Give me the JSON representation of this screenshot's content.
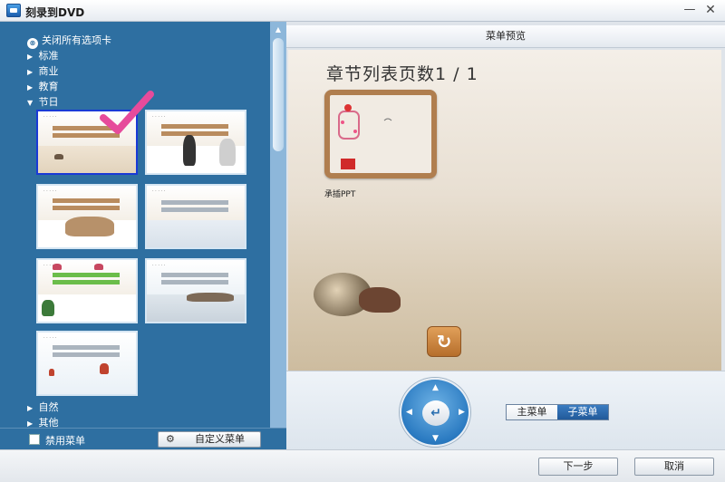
{
  "window": {
    "title": "刻录到DVD",
    "min_glyph": "—",
    "close_glyph": "✕"
  },
  "tree": {
    "close_all": "关闭所有选项卡",
    "categories": [
      {
        "label": "标准",
        "expanded": false
      },
      {
        "label": "商业",
        "expanded": false
      },
      {
        "label": "教育",
        "expanded": false
      },
      {
        "label": "节日",
        "expanded": true
      },
      {
        "label": "自然",
        "expanded": false
      },
      {
        "label": "其他",
        "expanded": false
      }
    ],
    "selected_template_index": 0
  },
  "left_bottom": {
    "disable_menu_label": "禁用菜单",
    "disable_menu_checked": false,
    "custom_menu_label": "自定义菜单"
  },
  "preview": {
    "header": "菜单预览",
    "page_title": "章节列表页数1 / 1",
    "chapter_caption": "承插PPT",
    "back_icon": "return-arrow-icon"
  },
  "controls": {
    "tab_main": "主菜单",
    "tab_sub": "子菜单",
    "active_tab": "子菜单"
  },
  "footer": {
    "next_label": "下一步",
    "cancel_label": "取消"
  },
  "colors": {
    "panel_blue": "#2e6fa1",
    "selected_border": "#1a3ad6",
    "check_mark": "#e64b9b",
    "frame_brown": "#b07e4f"
  }
}
